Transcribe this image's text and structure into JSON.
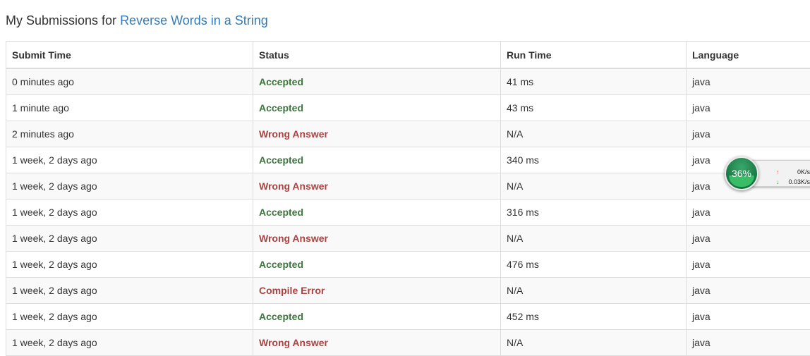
{
  "page": {
    "heading_prefix": "My Submissions for",
    "problem_link": "Reverse Words in a String"
  },
  "table": {
    "headers": [
      "Submit Time",
      "Status",
      "Run Time",
      "Language"
    ],
    "rows": [
      {
        "time": "0 minutes ago",
        "status": "Accepted",
        "runtime": "41 ms",
        "language": "java"
      },
      {
        "time": "1 minute ago",
        "status": "Accepted",
        "runtime": "43 ms",
        "language": "java"
      },
      {
        "time": "2 minutes ago",
        "status": "Wrong Answer",
        "runtime": "N/A",
        "language": "java"
      },
      {
        "time": "1 week, 2 days ago",
        "status": "Accepted",
        "runtime": "340 ms",
        "language": "java"
      },
      {
        "time": "1 week, 2 days ago",
        "status": "Wrong Answer",
        "runtime": "N/A",
        "language": "java"
      },
      {
        "time": "1 week, 2 days ago",
        "status": "Accepted",
        "runtime": "316 ms",
        "language": "java"
      },
      {
        "time": "1 week, 2 days ago",
        "status": "Wrong Answer",
        "runtime": "N/A",
        "language": "java"
      },
      {
        "time": "1 week, 2 days ago",
        "status": "Accepted",
        "runtime": "476 ms",
        "language": "java"
      },
      {
        "time": "1 week, 2 days ago",
        "status": "Compile Error",
        "runtime": "N/A",
        "language": "java"
      },
      {
        "time": "1 week, 2 days ago",
        "status": "Accepted",
        "runtime": "452 ms",
        "language": "java"
      },
      {
        "time": "1 week, 2 days ago",
        "status": "Wrong Answer",
        "runtime": "N/A",
        "language": "java"
      }
    ]
  },
  "widget": {
    "percent": "36%",
    "upload": "0K/s",
    "download": "0.03K/s",
    "up_icon": "arrow-up-icon",
    "down_icon": "arrow-down-icon",
    "add_icon": "plus-icon"
  },
  "colors": {
    "link": "#337ab7",
    "accepted": "#3c763d",
    "rejected": "#a94442"
  }
}
